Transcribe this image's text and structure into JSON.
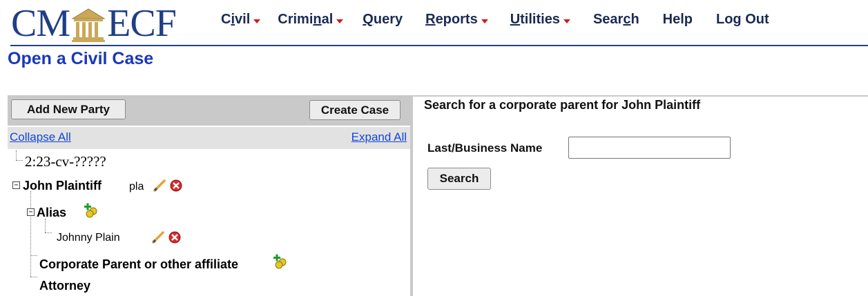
{
  "logo": {
    "left": "CM",
    "right": "ECF"
  },
  "menu": [
    {
      "pre": "C",
      "u": "i",
      "post": "vil",
      "dropdown": true
    },
    {
      "pre": "Crimi",
      "u": "n",
      "post": "al",
      "dropdown": true
    },
    {
      "pre": "",
      "u": "Q",
      "post": "uery",
      "dropdown": false
    },
    {
      "pre": "",
      "u": "R",
      "post": "eports",
      "dropdown": true
    },
    {
      "pre": "",
      "u": "U",
      "post": "tilities",
      "dropdown": true
    },
    {
      "pre": "Sear",
      "u": "c",
      "post": "h",
      "dropdown": false
    },
    {
      "pre": "Help",
      "u": "",
      "post": "",
      "dropdown": false
    },
    {
      "pre": "Log Out",
      "u": "",
      "post": "",
      "dropdown": false
    }
  ],
  "page_title": "Open a Civil Case",
  "left_panel": {
    "add_party_label": "Add New Party",
    "create_case_label": "Create Case",
    "collapse_all": "Collapse All",
    "expand_all": "Expand All",
    "tree": {
      "case_number": "2:23-cv-?????",
      "party_name": "John Plaintiff",
      "party_role": "pla",
      "alias_label": "Alias",
      "alias_name": "Johnny Plain",
      "corporate_parent_label": "Corporate Parent or other affiliate",
      "attorney_label": "Attorney"
    }
  },
  "right_panel": {
    "heading": "Search for a corporate parent for John Plaintiff",
    "last_name_label": "Last/Business Name",
    "last_name_value": "",
    "search_label": "Search"
  },
  "icons": {
    "edit": "pencil-icon",
    "delete": "delete-icon",
    "add": "add-person-icon",
    "expand_box": "minus-box-icon"
  },
  "colors": {
    "brand_blue": "#1f3e86",
    "title_blue": "#1a38b8",
    "link_blue": "#1144dd",
    "caret_red": "#d51a1a",
    "panel_gray": "#c9c9c9"
  }
}
